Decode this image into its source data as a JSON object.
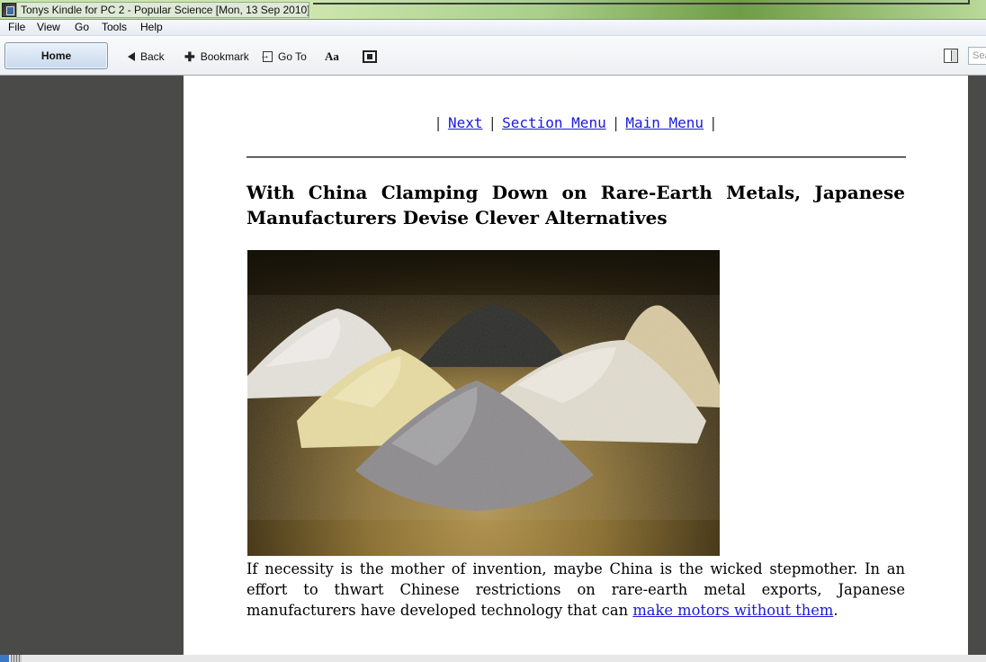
{
  "window": {
    "title": "Tonys Kindle for PC 2 - Popular Science [Mon, 13 Sep 2010]"
  },
  "menu": {
    "items": [
      "File",
      "View",
      "Go",
      "Tools",
      "Help"
    ]
  },
  "toolbar": {
    "home_label": "Home",
    "back_label": "Back",
    "bookmark_label": "Bookmark",
    "goto_label": "Go To",
    "font_label": "Aa",
    "search_placeholder": "Sea"
  },
  "article": {
    "nav": {
      "next": "Next",
      "section_menu": "Section Menu",
      "main_menu": "Main Menu",
      "separator": "|"
    },
    "headline": "With China Clamping Down on Rare-Earth Metals, Japanese Manufacturers Devise Clever Alternatives",
    "body_before_link": "If necessity is the mother of invention, maybe China is the wicked stepmother. In an effort to thwart Chinese restrictions on rare-earth metal exports, Japanese manufacturers have developed technology that can ",
    "body_link": "make motors without them",
    "body_after_link": "."
  },
  "colors": {
    "link": "#1a1adb",
    "background_dark": "#4a4a48",
    "page": "#ffffff"
  }
}
